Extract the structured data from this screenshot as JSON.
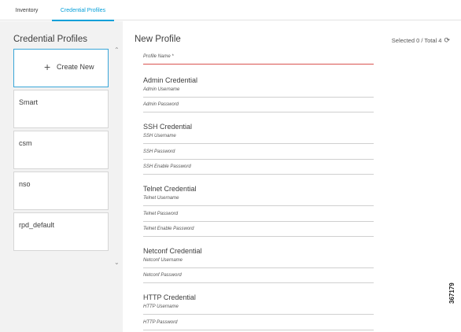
{
  "tabs": [
    "Inventory",
    "Credential Profiles"
  ],
  "left": {
    "title": "Credential Profiles",
    "create_new": "Create New",
    "profiles": [
      "Smart",
      "csm",
      "nso",
      "rpd_default"
    ]
  },
  "right": {
    "title": "New Profile",
    "selected_total": "Selected 0 / Total 4",
    "profile_name_placeholder": "Profile Name *",
    "sections": [
      {
        "title": "Admin Credential",
        "fields": [
          "Admin Username",
          "Admin Password"
        ]
      },
      {
        "title": "SSH Credential",
        "fields": [
          "SSH Username",
          "SSH Password",
          "SSH Enable Password"
        ]
      },
      {
        "title": "Telnet Credential",
        "fields": [
          "Telnet Username",
          "Telnet Password",
          "Telnet Enable Password"
        ]
      },
      {
        "title": "Netconf Credential",
        "fields": [
          "Netconf Username",
          "Netconf Password"
        ]
      },
      {
        "title": "HTTP Credential",
        "fields": [
          "HTTP Username",
          "HTTP Password"
        ]
      }
    ]
  },
  "figure_id": "367179",
  "colors": {
    "accent": "#049fd9",
    "error_underline": "#d9534f",
    "left_panel_bg": "#f2f2f2"
  },
  "icons": {
    "create": "plus-icon",
    "refresh": "refresh-icon",
    "scroll_up": "chevron-up-icon",
    "scroll_down": "chevron-down-icon"
  }
}
